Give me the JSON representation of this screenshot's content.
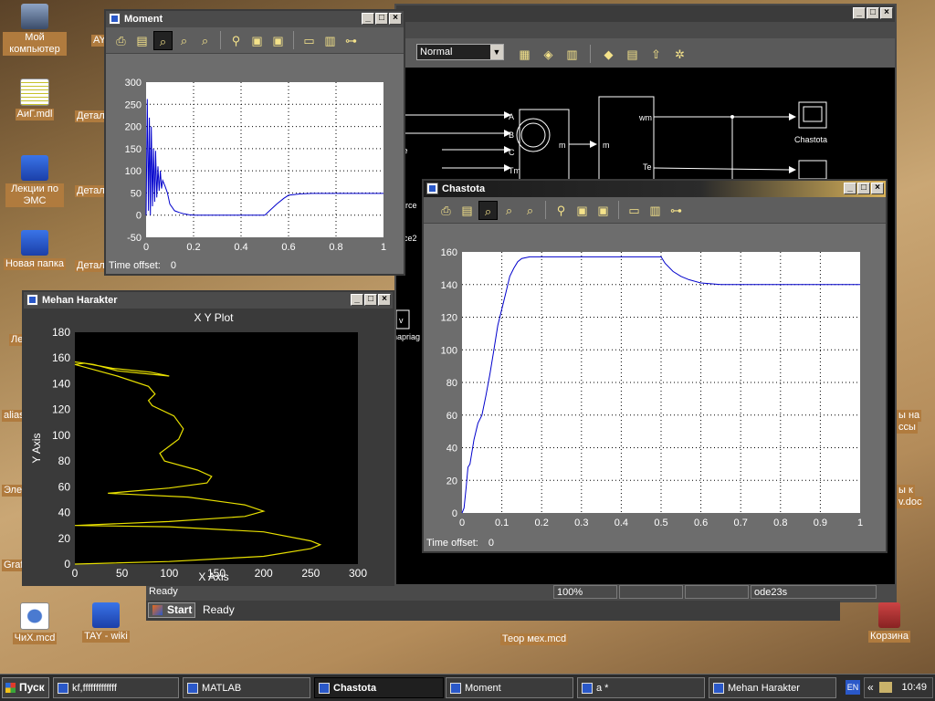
{
  "desktop": {
    "icons": [
      {
        "label": "Мой компьютер"
      },
      {
        "label": "АиГ.mdl"
      },
      {
        "label": "Лекции по ЭМС"
      },
      {
        "label": "Новая папка"
      },
      {
        "label": "ЧиХ.mcd"
      },
      {
        "label": "TAY - wiki"
      },
      {
        "label": "Теор мех.mcd"
      },
      {
        "label": "Корзина"
      }
    ],
    "partial_labels": [
      "AY",
      "Детал",
      "Детал",
      "Детал",
      "Лек",
      "alias",
      "Элек",
      "Graf",
      "ы на",
      "ссы",
      "ы к",
      "v.doc"
    ]
  },
  "simulink": {
    "zoom_mode": "Normal",
    "blocks": {
      "chastota": "Chastota",
      "wm": "wm",
      "te": "Te",
      "m_out": "m",
      "m_in": "m",
      "in_a": "A",
      "in_b": "B",
      "in_c": "C",
      "in_tm": "Tm",
      "src1": "rce",
      "src2": "ource",
      "src3": "urce2",
      "v": "v",
      "napr": "napriag"
    },
    "status": {
      "ready": "Ready",
      "zoom": "100%",
      "cell3": "",
      "cell4": "",
      "solver": "ode23s"
    },
    "start_button": "Start",
    "start_status": "Ready"
  },
  "moment": {
    "title": "Moment",
    "offset_label": "Time offset:",
    "offset_value": "0",
    "chart_data": {
      "type": "line",
      "xlim": [
        0,
        1
      ],
      "ylim": [
        -50,
        300
      ],
      "xticks": [
        "0",
        "0.2",
        "0.4",
        "0.6",
        "0.8",
        "1"
      ],
      "yticks": [
        "-50",
        "0",
        "50",
        "100",
        "150",
        "200",
        "250",
        "300"
      ],
      "grid": true,
      "series": [
        {
          "color": "#0000cc",
          "x": [
            0,
            0.005,
            0.01,
            0.014,
            0.018,
            0.022,
            0.027,
            0.031,
            0.036,
            0.04,
            0.045,
            0.05,
            0.055,
            0.06,
            0.065,
            0.07,
            0.08,
            0.09,
            0.1,
            0.12,
            0.14,
            0.16,
            0.18,
            0.2,
            0.25,
            0.3,
            0.35,
            0.4,
            0.45,
            0.5,
            0.52,
            0.55,
            0.58,
            0.6,
            0.65,
            0.7,
            1.0
          ],
          "y": [
            0,
            262,
            10,
            220,
            0,
            200,
            20,
            150,
            30,
            145,
            40,
            110,
            55,
            100,
            60,
            78,
            65,
            50,
            25,
            10,
            6,
            3,
            1,
            0,
            0,
            0,
            0,
            0,
            0,
            0,
            10,
            25,
            38,
            45,
            48,
            49,
            49
          ]
        }
      ]
    }
  },
  "mehan": {
    "title": "Mehan Harakter",
    "chart_data": {
      "type": "line",
      "title": "X Y Plot",
      "xlabel": "X Axis",
      "ylabel": "Y Axis",
      "xlim": [
        0,
        300
      ],
      "ylim": [
        0,
        180
      ],
      "xticks": [
        "0",
        "50",
        "100",
        "150",
        "200",
        "250",
        "300"
      ],
      "yticks": [
        "0",
        "20",
        "40",
        "60",
        "80",
        "100",
        "120",
        "140",
        "160",
        "180"
      ],
      "grid": false,
      "series": [
        {
          "color": "#e8e000",
          "x": [
            0,
            100,
            200,
            250,
            260,
            250,
            200,
            100,
            0,
            100,
            180,
            200,
            180,
            120,
            35,
            100,
            140,
            145,
            130,
            95,
            90,
            110,
            115,
            105,
            82,
            78,
            85,
            78,
            45,
            0,
            10,
            40,
            80,
            100,
            45,
            20,
            0
          ],
          "y": [
            0,
            2,
            6,
            12,
            15,
            18,
            25,
            29,
            30,
            33,
            37,
            41,
            46,
            52,
            55,
            59,
            63,
            68,
            73,
            80,
            86,
            97,
            105,
            115,
            123,
            127,
            132,
            138,
            146,
            155,
            156,
            152,
            149,
            146,
            150,
            155,
            157
          ]
        }
      ]
    }
  },
  "chastota": {
    "title": "Chastota",
    "offset_label": "Time offset:",
    "offset_value": "0",
    "chart_data": {
      "type": "line",
      "xlim": [
        0,
        1
      ],
      "ylim": [
        0,
        160
      ],
      "xticks": [
        "0",
        "0.1",
        "0.2",
        "0.3",
        "0.4",
        "0.5",
        "0.6",
        "0.7",
        "0.8",
        "0.9",
        "1"
      ],
      "yticks": [
        "0",
        "20",
        "40",
        "60",
        "80",
        "100",
        "120",
        "140",
        "160"
      ],
      "grid": true,
      "series": [
        {
          "color": "#0000cc",
          "x": [
            0,
            0.005,
            0.01,
            0.015,
            0.02,
            0.03,
            0.04,
            0.05,
            0.06,
            0.07,
            0.08,
            0.09,
            0.1,
            0.11,
            0.12,
            0.13,
            0.14,
            0.15,
            0.17,
            0.2,
            0.25,
            0.3,
            0.4,
            0.49,
            0.5,
            0.51,
            0.53,
            0.55,
            0.57,
            0.6,
            0.65,
            0.7,
            0.8,
            0.9,
            1.0
          ],
          "y": [
            0,
            3,
            15,
            28,
            30,
            45,
            55,
            60,
            72,
            85,
            100,
            115,
            125,
            135,
            145,
            150,
            154,
            156,
            157,
            157,
            157,
            157,
            157,
            157,
            157,
            153,
            148,
            145,
            143,
            141,
            140,
            140,
            140,
            140,
            140
          ]
        }
      ]
    }
  },
  "taskbar": {
    "start": "Пуск",
    "items": [
      "kf,fffffffffffff",
      "MATLAB",
      "Chastota",
      "Moment",
      "a *",
      "Mehan Harakter"
    ],
    "lang": "EN",
    "clock": "10:49"
  }
}
